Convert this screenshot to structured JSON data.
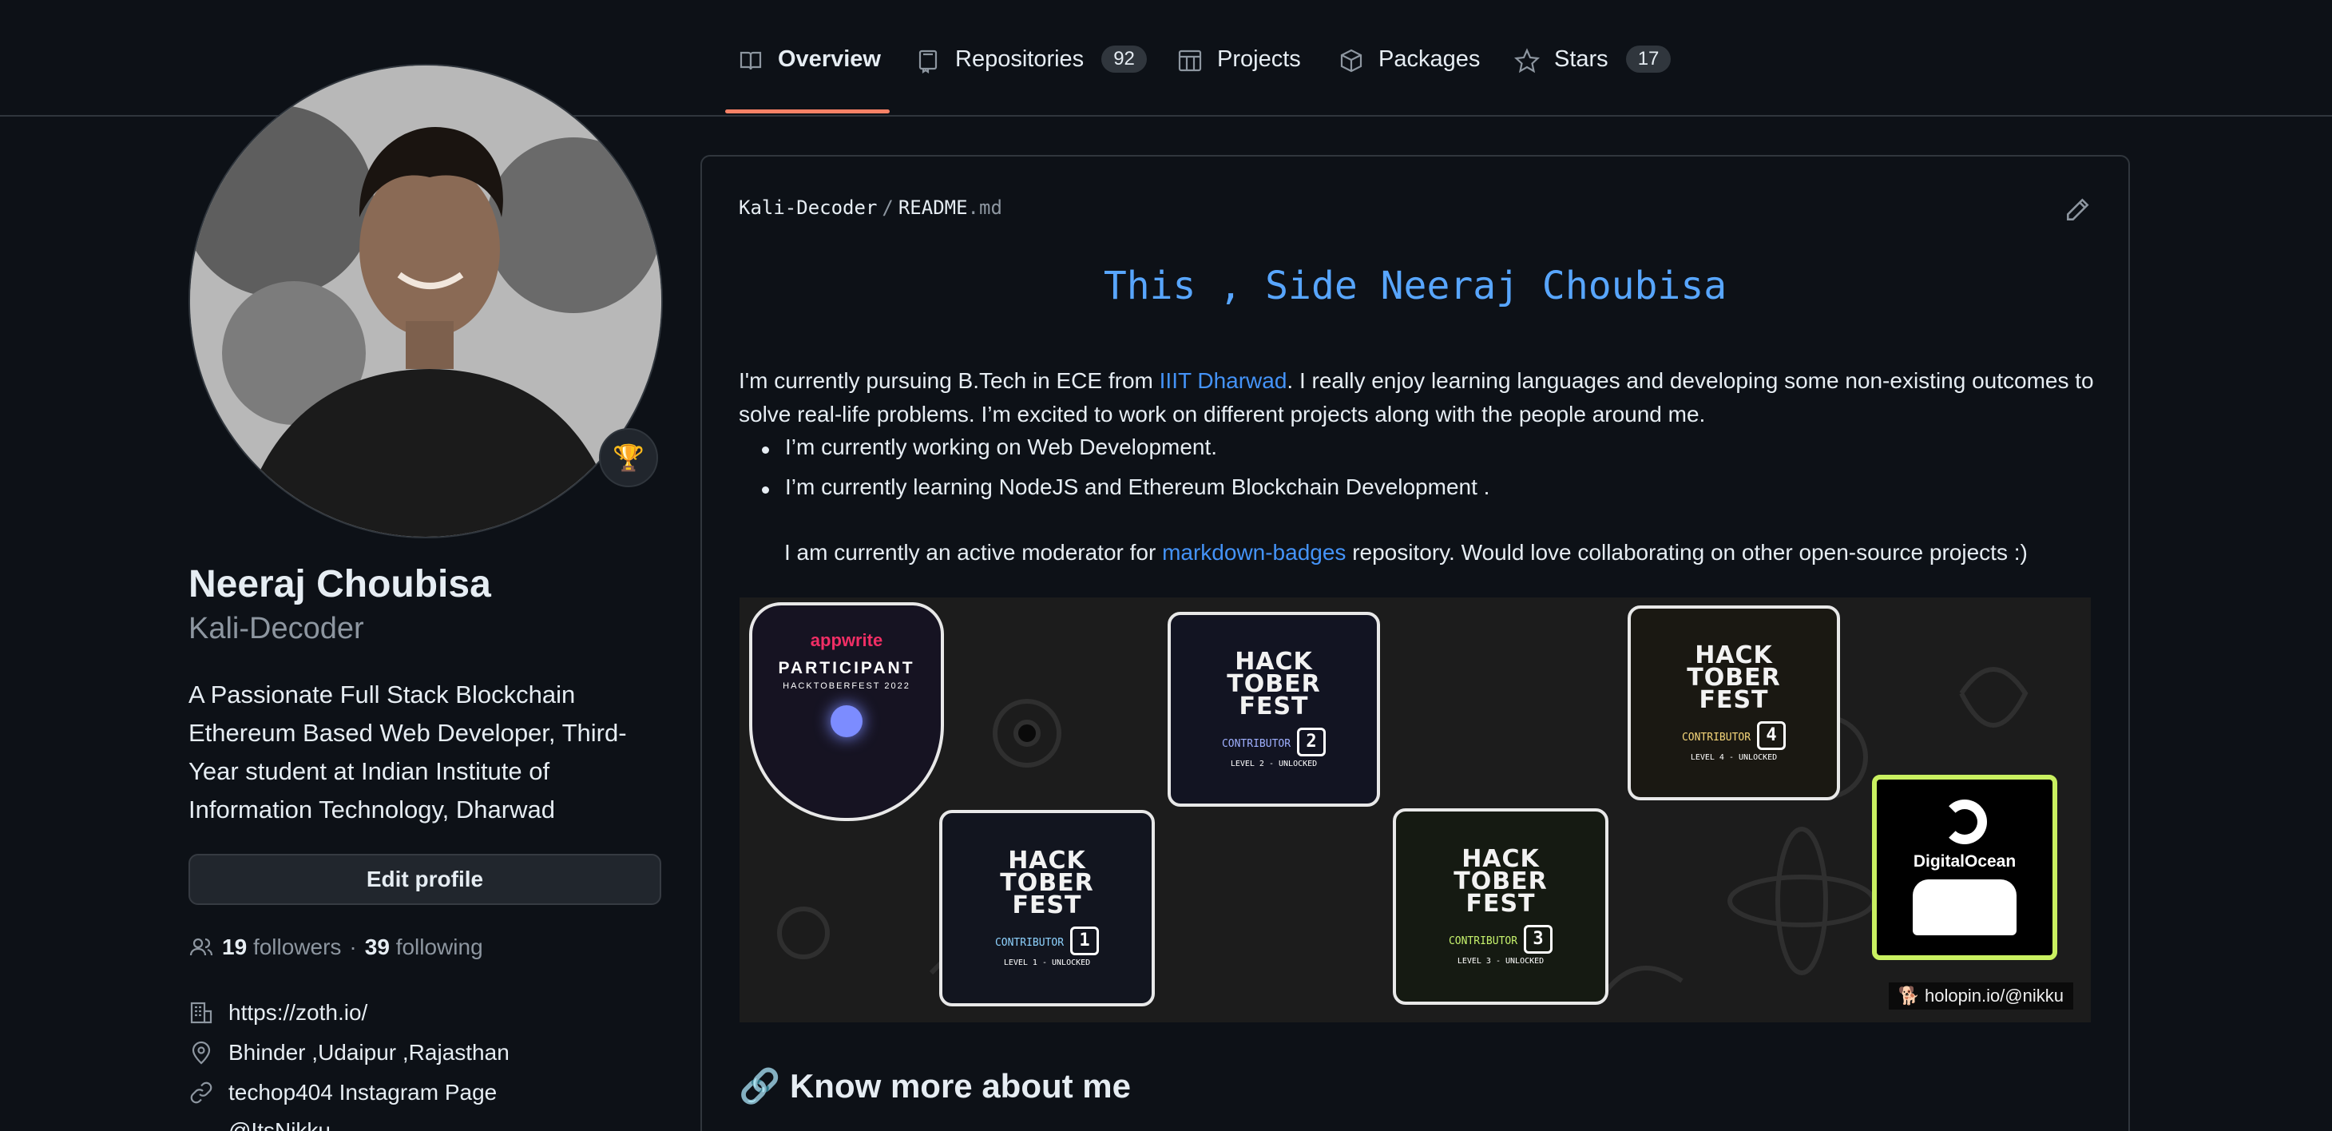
{
  "nav": {
    "tabs": [
      {
        "label": "Overview"
      },
      {
        "label": "Repositories",
        "count": "92"
      },
      {
        "label": "Projects"
      },
      {
        "label": "Packages"
      },
      {
        "label": "Stars",
        "count": "17"
      }
    ]
  },
  "profile": {
    "full_name": "Neeraj Choubisa",
    "login": "Kali-Decoder",
    "bio": "A Passionate Full Stack Blockchain Ethereum Based Web Developer, Third-Year student at Indian Institute of Information Technology, Dharwad",
    "edit_label": "Edit profile",
    "followers_count": "19",
    "followers_label": "followers",
    "following_count": "39",
    "following_label": "following",
    "website": "https://zoth.io/",
    "location": "Bhinder ,Udaipur ,Rajasthan",
    "social_link": "techop404 Instagram Page",
    "twitter": "@ItsNikku"
  },
  "readme": {
    "path_owner": "Kali-Decoder",
    "path_file": "README",
    "path_ext": ".md",
    "title": "This , Side Neeraj Choubisa",
    "intro_before": "I'm currently pursuing B.Tech in ECE from ",
    "intro_link": "IIIT Dharwad",
    "intro_after": ". I really enjoy learning languages and developing some non-existing outcomes to solve real-life problems. I’m excited to work on different projects along with the people around me.",
    "bullets": [
      "I’m currently working on Web Development.",
      "I’m currently learning NodeJS and Ethereum Blockchain Development ."
    ],
    "moderator_before": "I am currently an active moderator for ",
    "moderator_link": "markdown-badges",
    "moderator_after": " repository. Would love collaborating on other open-source projects :)",
    "badges": {
      "appwrite_brand": "appwrite",
      "appwrite_title": "PARTICIPANT",
      "appwrite_sub": "HACKTOBERFEST 2022",
      "hack_line1": "HACK",
      "hack_line2": "TOBER",
      "hack_line3": "FEST",
      "contributor": "CONTRIBUTOR",
      "level2_label": "LEVEL 2 - UNLOCKED",
      "level4_label": "LEVEL 4 - UNLOCKED",
      "level1_label": "LEVEL 1 - UNLOCKED",
      "level3_label": "LEVEL 3 - UNLOCKED",
      "digitalocean": "DigitalOcean",
      "holopin": "🐕 holopin.io/@nikku"
    },
    "know_more": "🔗 Know more about me"
  },
  "colors": {
    "background": "#0d1117",
    "accent_tab": "#f78166",
    "link": "#4493f8",
    "title": "#58a6ff"
  }
}
